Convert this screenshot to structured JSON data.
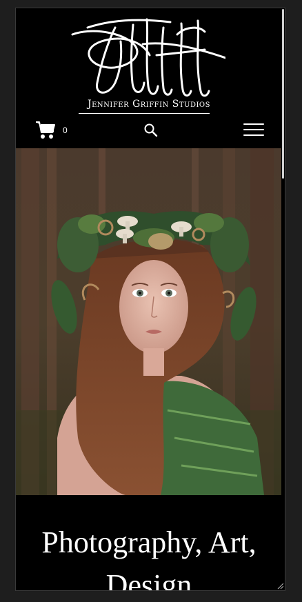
{
  "header": {
    "logo_icon": "signature-logo",
    "brand_name": "Jennifer Griffin Studios",
    "cart_count": "0",
    "cart_icon": "shopping-cart-icon",
    "search_icon": "search-icon",
    "menu_icon": "hamburger-menu-icon"
  },
  "hero": {
    "image_subject": "photo"
  },
  "content": {
    "headline": "Photography, Art, Design"
  },
  "colors": {
    "background": "#000000",
    "text": "#ffffff",
    "outer": "#1e1e1e"
  }
}
